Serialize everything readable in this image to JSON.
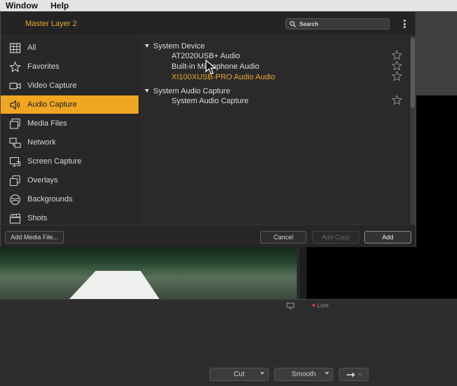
{
  "menubar": {
    "items": [
      "Window",
      "Help"
    ]
  },
  "dialog": {
    "title": "Master Layer 2",
    "search": {
      "placeholder": "Search"
    },
    "sidebar": {
      "items": [
        {
          "label": "All",
          "icon": "grid-icon",
          "active": false
        },
        {
          "label": "Favorites",
          "icon": "star-icon",
          "active": false
        },
        {
          "label": "Video Capture",
          "icon": "video-camera-icon",
          "active": false
        },
        {
          "label": "Audio Capture",
          "icon": "speaker-icon",
          "active": true
        },
        {
          "label": "Media Files",
          "icon": "media-files-icon",
          "active": false
        },
        {
          "label": "Network",
          "icon": "network-icon",
          "active": false
        },
        {
          "label": "Screen Capture",
          "icon": "screen-capture-icon",
          "active": false
        },
        {
          "label": "Overlays",
          "icon": "overlays-icon",
          "active": false
        },
        {
          "label": "Backgrounds",
          "icon": "backgrounds-icon",
          "active": false
        },
        {
          "label": "Shots",
          "icon": "clapperboard-icon",
          "active": false
        }
      ]
    },
    "sources": {
      "groups": [
        {
          "label": "System Device",
          "items": [
            {
              "label": "AT2020USB+ Audio",
              "highlighted": false
            },
            {
              "label": "Built-in Microphone Audio",
              "highlighted": false
            },
            {
              "label": "XI100XUSB-PRO Audio Audio",
              "highlighted": true
            }
          ]
        },
        {
          "label": "System Audio Capture",
          "items": [
            {
              "label": "System Audio Capture",
              "highlighted": false
            }
          ]
        }
      ]
    },
    "footer": {
      "add_media_file": "Add Media File...",
      "cancel": "Cancel",
      "add_copy": "Add Copy",
      "add": "Add"
    }
  },
  "background": {
    "live_label": "Live",
    "transition_select": "Cut",
    "easing_select": "Smooth",
    "transition_button_suffix": "○"
  },
  "colors": {
    "accent": "#f0a623",
    "highlight_text": "#e8a82e",
    "dialog_bg": "#262626",
    "live_dot": "#d23b3b"
  }
}
